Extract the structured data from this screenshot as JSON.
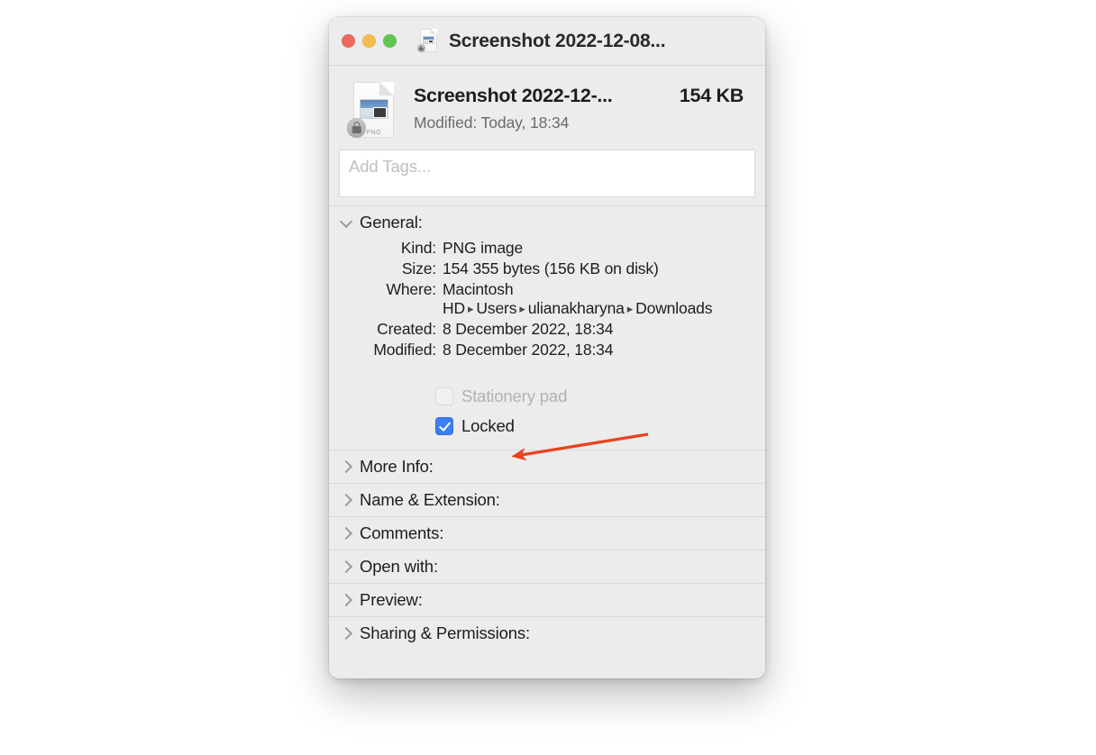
{
  "window": {
    "title": "Screenshot 2022-12-08...",
    "title_icon": "png-document-locked-icon",
    "traffic_lights": {
      "close_label": "close",
      "minimize_label": "minimize",
      "zoom_label": "zoom",
      "close_color": "#ED6A5E",
      "minimize_color": "#F4BD4F",
      "zoom_color": "#61C554"
    }
  },
  "header": {
    "icon": "png-document-locked-icon",
    "icon_type_label": "PNG",
    "file_name": "Screenshot 2022-12-...",
    "file_size": "154 KB",
    "modified_line": "Modified: Today, 18:34"
  },
  "tags": {
    "placeholder": "Add Tags...",
    "value": ""
  },
  "general": {
    "title": "General:",
    "expanded": true,
    "rows": [
      {
        "label": "Kind:",
        "value": "PNG image"
      },
      {
        "label": "Size:",
        "value": "154 355 bytes (156 KB on disk)"
      },
      {
        "label": "Where:",
        "value": "Macintosh HD ▸ Users ▸ ulianakharyna ▸ Downloads"
      },
      {
        "label": "Created:",
        "value": "8 December 2022, 18:34"
      },
      {
        "label": "Modified:",
        "value": "8 December 2022, 18:34"
      }
    ],
    "where_parts": {
      "part1": "Macintosh HD",
      "part2": "Users",
      "part3": "ulianakharyna",
      "part4": "Downloads",
      "separator": "▸"
    },
    "checkboxes": [
      {
        "label": "Stationery pad",
        "checked": false,
        "disabled": true
      },
      {
        "label": "Locked",
        "checked": true,
        "disabled": false
      }
    ]
  },
  "sections": [
    {
      "title": "More Info:",
      "expanded": false
    },
    {
      "title": "Name & Extension:",
      "expanded": false
    },
    {
      "title": "Comments:",
      "expanded": false
    },
    {
      "title": "Open with:",
      "expanded": false
    },
    {
      "title": "Preview:",
      "expanded": false
    },
    {
      "title": "Sharing & Permissions:",
      "expanded": false
    }
  ],
  "annotation": {
    "type": "arrow",
    "color": "#E8441F",
    "points_at": "locked-checkbox"
  }
}
